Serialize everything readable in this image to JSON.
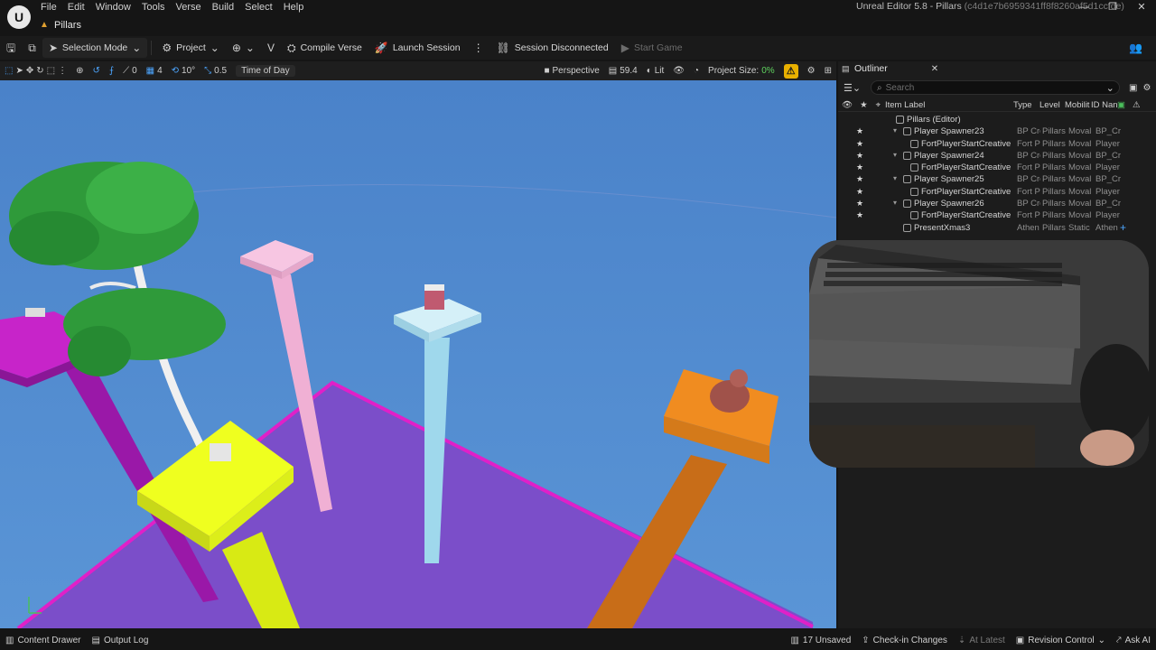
{
  "window": {
    "app_title": "Unreal Editor 5.8 - Pillars",
    "hash": "(c4d1e7b6959341ff8f8260af5d1ccfde)",
    "document_tab": "Pillars"
  },
  "menu": [
    "File",
    "Edit",
    "Window",
    "Tools",
    "Verse",
    "Build",
    "Select",
    "Help"
  ],
  "toolbar": {
    "selection_mode": "Selection Mode",
    "project": "Project",
    "compile_verse": "Compile Verse",
    "launch_session": "Launch Session",
    "session_status": "Session Disconnected",
    "start_game": "Start Game"
  },
  "viewport": {
    "snap_rotation_count": "0",
    "snap_grid": "4",
    "snap_angle": "10°",
    "snap_scale": "0.5",
    "time_of_day": "Time of Day",
    "perspective": "Perspective",
    "fov": "59.4",
    "lit": "Lit",
    "project_size_label": "Project Size:",
    "project_size_value": "0%",
    "colors": {
      "sky": "#4a87cc",
      "floor": "#7b4ec9",
      "floor_edge": "#e020c8",
      "pillar_magenta": "#c021c7",
      "pillar_pink": "#f3b7d8",
      "pillar_cyan": "#9fd8ec",
      "pillar_yellow": "#efff1f",
      "pillar_orange": "#e8801c"
    }
  },
  "outliner": {
    "title": "Outliner",
    "search_placeholder": "Search",
    "columns": {
      "item_label": "Item Label",
      "type": "Type",
      "level": "Level",
      "mobility": "Mobilit",
      "id_name": "ID Nan"
    },
    "root": "Pillars (Editor)",
    "rows": [
      {
        "label": "Player Spawner23",
        "type": "BP Cre",
        "level": "Pillars",
        "mobility": "Moval",
        "id": "BP_Cr",
        "indent": 1,
        "expand": true
      },
      {
        "label": "FortPlayerStartCreative",
        "type": "Fort P",
        "level": "Pillars",
        "mobility": "Moval",
        "id": "Player",
        "indent": 2,
        "expand": false
      },
      {
        "label": "Player Spawner24",
        "type": "BP Cre",
        "level": "Pillars",
        "mobility": "Moval",
        "id": "BP_Cr",
        "indent": 1,
        "expand": true
      },
      {
        "label": "FortPlayerStartCreative",
        "type": "Fort P",
        "level": "Pillars",
        "mobility": "Moval",
        "id": "Player",
        "indent": 2,
        "expand": false
      },
      {
        "label": "Player Spawner25",
        "type": "BP Cre",
        "level": "Pillars",
        "mobility": "Moval",
        "id": "BP_Cr",
        "indent": 1,
        "expand": true
      },
      {
        "label": "FortPlayerStartCreative",
        "type": "Fort P",
        "level": "Pillars",
        "mobility": "Moval",
        "id": "Player",
        "indent": 2,
        "expand": false
      },
      {
        "label": "Player Spawner26",
        "type": "BP Cre",
        "level": "Pillars",
        "mobility": "Moval",
        "id": "BP_Cr",
        "indent": 1,
        "expand": true
      },
      {
        "label": "FortPlayerStartCreative",
        "type": "Fort P",
        "level": "Pillars",
        "mobility": "Moval",
        "id": "Player",
        "indent": 2,
        "expand": false
      },
      {
        "label": "PresentXmas3",
        "type": "Athen",
        "level": "Pillars",
        "mobility": "Static",
        "id": "Athen",
        "indent": 1,
        "expand": false
      }
    ]
  },
  "statusbar": {
    "content_drawer": "Content Drawer",
    "output_log": "Output Log",
    "unsaved": "17 Unsaved",
    "checkin": "Check-in Changes",
    "at_latest": "At Latest",
    "revision_control": "Revision Control",
    "ask_ai": "Ask AI"
  }
}
